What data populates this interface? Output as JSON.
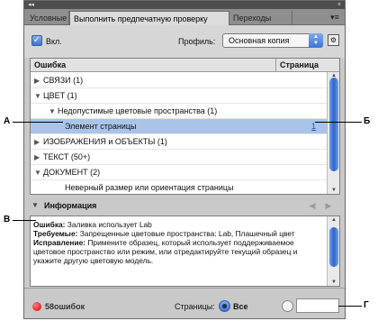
{
  "tabs": [
    {
      "label": "Условные"
    },
    {
      "label": "Выполнить предпечатную проверку"
    },
    {
      "label": "Переходы"
    }
  ],
  "topbar": {
    "collapse": "◂◂",
    "close": "×"
  },
  "on_label": "Вкл.",
  "profile": {
    "label": "Профиль:",
    "value": "Основная копия"
  },
  "list": {
    "col_error": "Ошибка",
    "col_page": "Страница",
    "rows": [
      {
        "text": "СВЯЗИ (1)",
        "expanded": false,
        "page": ""
      },
      {
        "text": "ЦВЕТ (1)",
        "expanded": true,
        "page": ""
      },
      {
        "text": "Недопустимые цветовые пространства (1)",
        "expanded": true,
        "page": ""
      },
      {
        "text": "Элемент страницы",
        "expanded": null,
        "page": "1"
      },
      {
        "text": "ИЗОБРАЖЕНИЯ и ОБЪЕКТЫ (1)",
        "expanded": false,
        "page": ""
      },
      {
        "text": "ТЕКСТ (50+)",
        "expanded": false,
        "page": ""
      },
      {
        "text": "ДОКУМЕНТ (2)",
        "expanded": true,
        "page": ""
      },
      {
        "text": "Неверный размер или ориентация страницы",
        "expanded": null,
        "page": ""
      }
    ]
  },
  "info": {
    "title": "Информация",
    "error_label": "Ошибка:",
    "error_text": "Заливка использует Lab",
    "required_label": "Требуемые:",
    "required_text": "Запрещенные цветовые пространства: Lab, Плашечный цвет",
    "fix_label": "Исправление:",
    "fix_text": "Примените образец, который использует поддерживаемое цветовое пространство или режим, или отредактируйте текущий образец и укажите другую цветовую модель."
  },
  "footer": {
    "errors": "58ошибок",
    "pages_label": "Страницы:",
    "all_label": "Все",
    "range_value": ""
  },
  "callouts": {
    "a": "А",
    "b": "Б",
    "v": "В",
    "g": "Г"
  }
}
